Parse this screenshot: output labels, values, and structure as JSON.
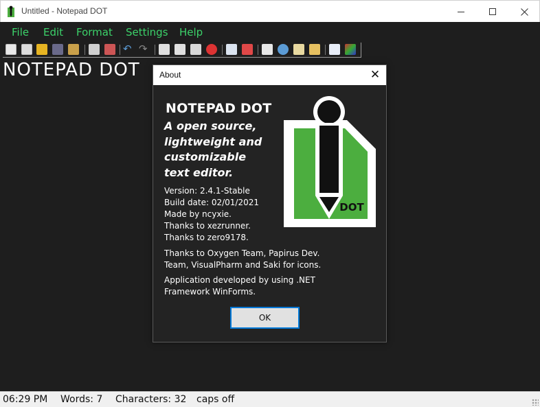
{
  "window": {
    "title": "Untitled - Notepad DOT"
  },
  "menu": {
    "items": [
      "File",
      "Edit",
      "Format",
      "Settings",
      "Help"
    ]
  },
  "toolbar": {
    "buttons": [
      "new-file-icon",
      "new-window-icon",
      "open-icon",
      "save-icon",
      "save-as-icon",
      "print-icon",
      "print-preview-icon",
      "undo-icon",
      "redo-icon",
      "cut-icon",
      "copy-icon",
      "paste-icon",
      "delete-icon",
      "select-all-icon",
      "date-time-icon",
      "find-icon",
      "zoom-icon",
      "word-wrap-icon",
      "highlight-icon",
      "font-icon",
      "color-icon"
    ]
  },
  "editor": {
    "text": "NOTEPAD DOT"
  },
  "status": {
    "time": "06:29 PM",
    "words": "Words: 7",
    "characters": "Characters: 32",
    "caps": "caps off"
  },
  "about": {
    "dialog_title": "About",
    "close_label": "✕",
    "app_name": "NOTEPAD DOT",
    "tagline": [
      "A open source,",
      "lightweight and",
      "customizable",
      "text editor."
    ],
    "version": "Version: 2.4.1-Stable",
    "build_date": "Build date: 02/01/2021",
    "made_by": "Made by ncyxie.",
    "thanks_1": "Thanks to xezrunner.",
    "thanks_2": "Thanks to zero9178.",
    "icons_credit": "Thanks to Oxygen Team, Papirus Dev. Team, VisualPharm and Saki for icons.",
    "framework_credit": "Application developed by using .NET Framework WinForms.",
    "ok_label": "OK",
    "logo_text": "DOT"
  },
  "colors": {
    "menu_text": "#3cd26a",
    "background": "#1e1e1e",
    "logo_green": "#4cae3f",
    "ok_border": "#0078d7"
  }
}
